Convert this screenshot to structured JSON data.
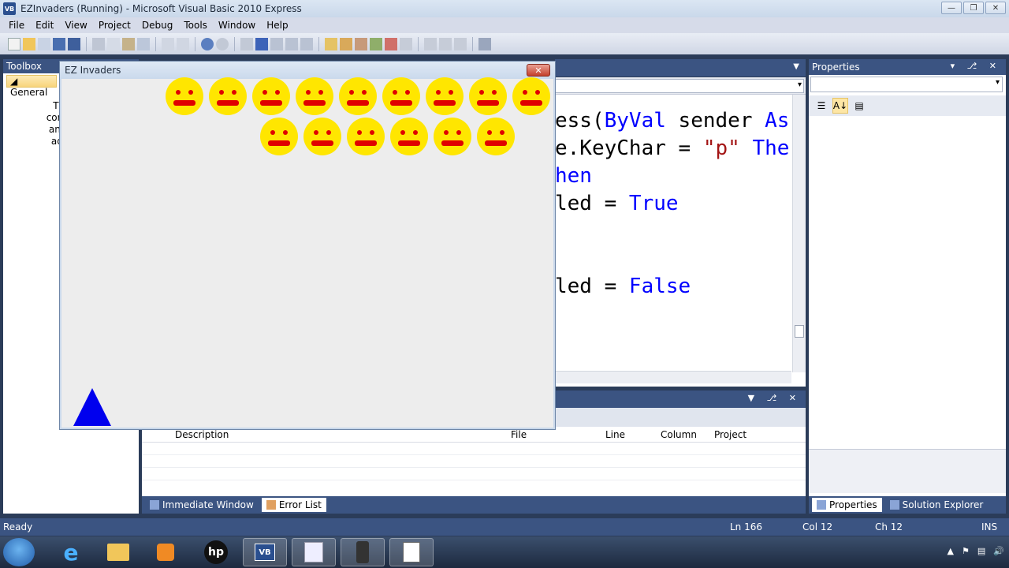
{
  "window": {
    "title": "EZInvaders (Running) - Microsoft Visual Basic 2010 Express",
    "app_icon_text": "VB",
    "controls": [
      "minimize-icon",
      "restore-icon",
      "close-icon"
    ]
  },
  "menu": {
    "items": [
      "File",
      "Edit",
      "View",
      "Project",
      "Debug",
      "Tools",
      "Window",
      "Help"
    ]
  },
  "toolbox": {
    "title": "Toolbox",
    "group": "General",
    "help_text_lines": [
      "There a",
      "controls in",
      "an item c",
      "add it to"
    ]
  },
  "editor": {
    "lines": [
      {
        "parts": [
          {
            "t": "ess(",
            "c": "plain"
          },
          {
            "t": "ByVal",
            "c": "kw"
          },
          {
            "t": " sender ",
            "c": "plain"
          },
          {
            "t": "As",
            "c": "kw"
          }
        ]
      },
      {
        "parts": [
          {
            "t": "e.KeyChar = ",
            "c": "plain"
          },
          {
            "t": "\"p\"",
            "c": "str"
          },
          {
            "t": " ",
            "c": "plain"
          },
          {
            "t": "The",
            "c": "kw"
          }
        ]
      },
      {
        "parts": [
          {
            "t": "hen",
            "c": "kw"
          }
        ]
      },
      {
        "parts": [
          {
            "t": "led = ",
            "c": "plain"
          },
          {
            "t": "True",
            "c": "kw"
          }
        ]
      },
      {
        "parts": [
          {
            "t": "",
            "c": "plain"
          }
        ]
      },
      {
        "parts": [
          {
            "t": "",
            "c": "plain"
          }
        ]
      },
      {
        "parts": [
          {
            "t": "led = ",
            "c": "plain"
          },
          {
            "t": "False",
            "c": "kw"
          }
        ]
      }
    ]
  },
  "properties": {
    "title": "Properties",
    "tabs": [
      "Properties",
      "Solution Explorer"
    ]
  },
  "error_list": {
    "columns": [
      "Description",
      "File",
      "Line",
      "Column",
      "Project"
    ],
    "tabs": [
      "Immediate Window",
      "Error List"
    ],
    "active_tab": "Error List"
  },
  "app": {
    "title": "EZ Invaders",
    "close_label": "✕",
    "invader_rows": [
      9,
      6
    ],
    "invader_color": "#ffe600",
    "invader_feature_color": "#e00000",
    "ship_color": "#0000ee"
  },
  "status": {
    "ready": "Ready",
    "ln": "Ln 166",
    "col": "Col 12",
    "ch": "Ch 12",
    "ins": "INS"
  },
  "taskbar": {
    "items": [
      "internet-explorer-icon",
      "file-explorer-icon",
      "media-player-icon",
      "hp-icon",
      "visual-basic-icon",
      "pdf-tool-icon",
      "camera-tool-icon",
      "notepad-icon"
    ],
    "active_index": 4
  }
}
